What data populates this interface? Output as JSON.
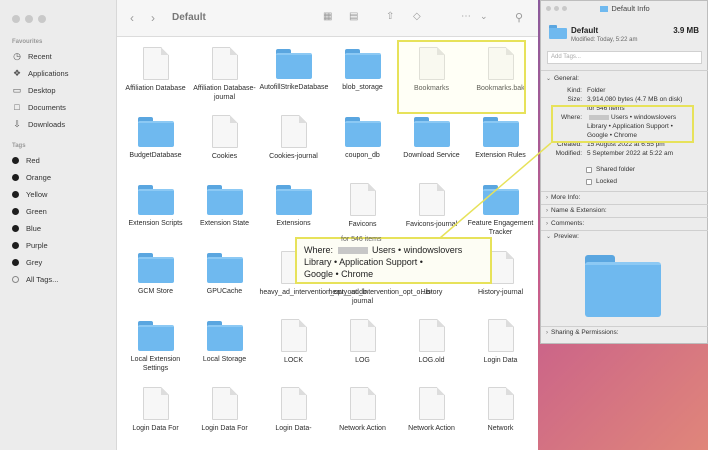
{
  "finder": {
    "title": "Default",
    "sidebar": {
      "favourites_heading": "Favourites",
      "favourites": [
        {
          "label": "Recent",
          "icon": "clock-icon"
        },
        {
          "label": "Applications",
          "icon": "applications-icon"
        },
        {
          "label": "Desktop",
          "icon": "desktop-icon"
        },
        {
          "label": "Documents",
          "icon": "document-icon"
        },
        {
          "label": "Downloads",
          "icon": "download-icon"
        }
      ],
      "tags_heading": "Tags",
      "tags": [
        {
          "label": "Red"
        },
        {
          "label": "Orange"
        },
        {
          "label": "Yellow"
        },
        {
          "label": "Green"
        },
        {
          "label": "Blue"
        },
        {
          "label": "Purple"
        },
        {
          "label": "Grey"
        },
        {
          "label": "All Tags..."
        }
      ]
    },
    "files": [
      {
        "name": "Affiliation Database",
        "kind": "file"
      },
      {
        "name": "Affiliation Database-journal",
        "kind": "file"
      },
      {
        "name": "AutofillStrikeDatabase",
        "kind": "folder"
      },
      {
        "name": "blob_storage",
        "kind": "folder"
      },
      {
        "name": "Bookmarks",
        "kind": "file"
      },
      {
        "name": "Bookmarks.bak",
        "kind": "file"
      },
      {
        "name": "BudgetDatabase",
        "kind": "folder"
      },
      {
        "name": "Cookies",
        "kind": "file"
      },
      {
        "name": "Cookies-journal",
        "kind": "file"
      },
      {
        "name": "coupon_db",
        "kind": "folder"
      },
      {
        "name": "Download Service",
        "kind": "folder"
      },
      {
        "name": "Extension Rules",
        "kind": "folder"
      },
      {
        "name": "Extension Scripts",
        "kind": "folder"
      },
      {
        "name": "Extension State",
        "kind": "folder"
      },
      {
        "name": "Extensions",
        "kind": "folder"
      },
      {
        "name": "Favicons",
        "kind": "file"
      },
      {
        "name": "Favicons-journal",
        "kind": "file"
      },
      {
        "name": "Feature Engagement Tracker",
        "kind": "folder"
      },
      {
        "name": "GCM Store",
        "kind": "folder"
      },
      {
        "name": "GPUCache",
        "kind": "folder"
      },
      {
        "name": "heavy_ad_intervention_opt_out.db",
        "kind": "file"
      },
      {
        "name": "heavy_ad_intervention_opt_o...b-journal",
        "kind": "file"
      },
      {
        "name": "History",
        "kind": "file"
      },
      {
        "name": "History-journal",
        "kind": "file"
      },
      {
        "name": "Local Extension Settings",
        "kind": "folder"
      },
      {
        "name": "Local Storage",
        "kind": "folder"
      },
      {
        "name": "LOCK",
        "kind": "file"
      },
      {
        "name": "LOG",
        "kind": "file"
      },
      {
        "name": "LOG.old",
        "kind": "file"
      },
      {
        "name": "Login Data",
        "kind": "file"
      },
      {
        "name": "Login Data For",
        "kind": "file"
      },
      {
        "name": "Login Data For",
        "kind": "file"
      },
      {
        "name": "Login Data-",
        "kind": "file"
      },
      {
        "name": "Network Action",
        "kind": "file"
      },
      {
        "name": "Network Action",
        "kind": "file"
      },
      {
        "name": "Network",
        "kind": "file"
      }
    ]
  },
  "info": {
    "window_title": "Default Info",
    "name": "Default",
    "size": "3.9 MB",
    "modified_short": "Modified: Today, 5:22 am",
    "tags_placeholder": "Add Tags...",
    "general": "General:",
    "kind_label": "Kind:",
    "kind_value": "Folder",
    "size_label": "Size:",
    "size_value": "3,914,080 bytes (4.7 MB on disk)",
    "size_items": "for 546 items",
    "where_label": "Where:",
    "where_value_1": "Users • windowslovers",
    "where_value_2": "Library • Application Support •",
    "where_value_3": "Google • Chrome",
    "created_label": "Created:",
    "created_value": "15 August 2022 at 6:55 pm",
    "modified_label": "Modified:",
    "modified_value": "5 September 2022 at 5:22 am",
    "shared_folder": "Shared folder",
    "locked": "Locked",
    "more_info": "More Info:",
    "name_ext": "Name & Extension:",
    "comments": "Comments:",
    "preview": "Preview:",
    "sharing": "Sharing & Permissions:"
  },
  "callout": {
    "peek": "for 546 items",
    "where_label": "Where:",
    "where_line1": "Users • windowslovers",
    "where_line2": "Library • Application Support •",
    "where_line3": "Google • Chrome"
  }
}
